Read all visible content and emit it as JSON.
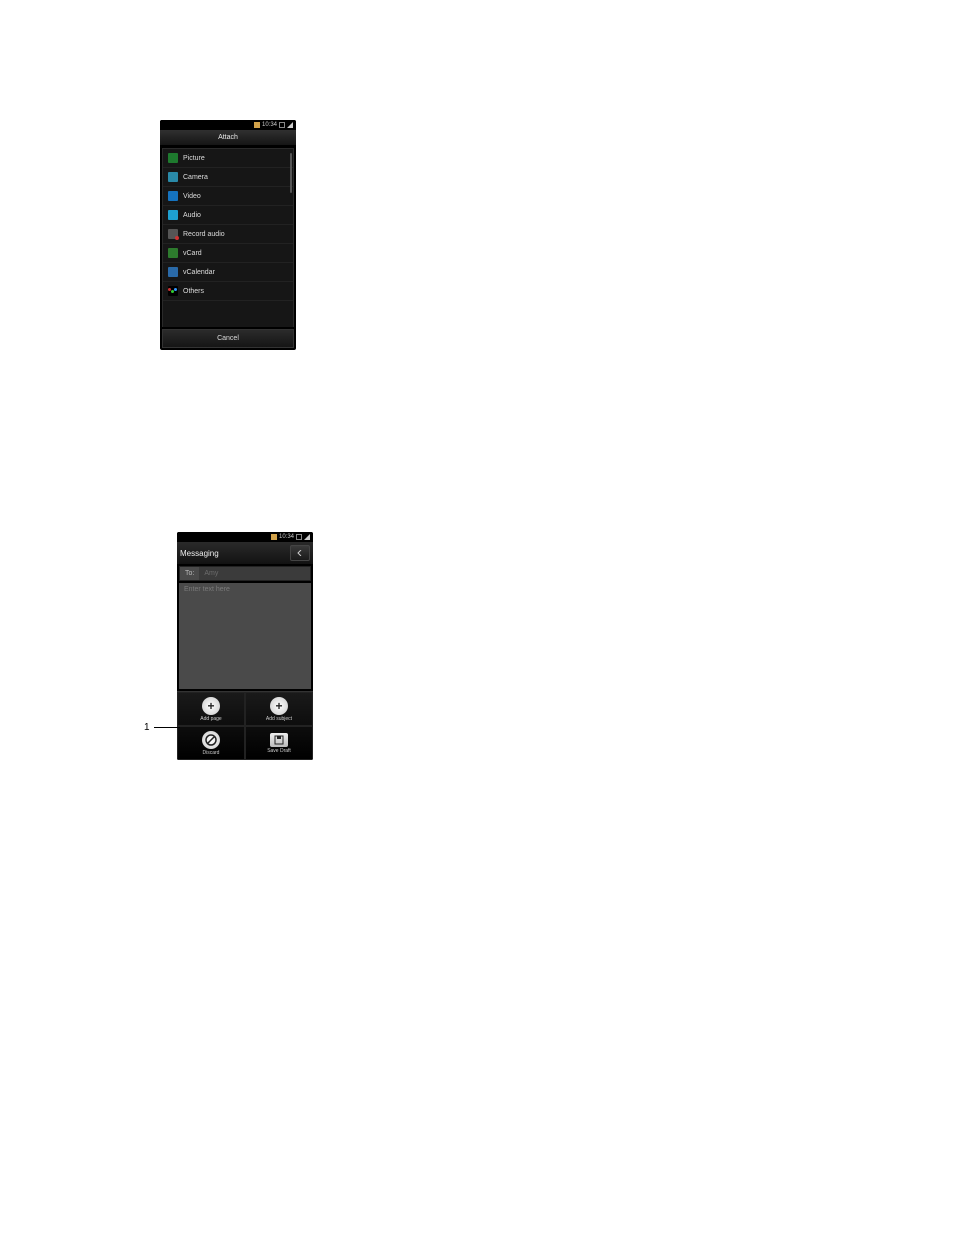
{
  "statusbar": {
    "time": "10:34"
  },
  "attach": {
    "title": "Attach",
    "items": [
      {
        "label": "Picture"
      },
      {
        "label": "Camera"
      },
      {
        "label": "Video"
      },
      {
        "label": "Audio"
      },
      {
        "label": "Record audio"
      },
      {
        "label": "vCard"
      },
      {
        "label": "vCalendar"
      },
      {
        "label": "Others"
      }
    ],
    "cancel": "Cancel"
  },
  "messaging": {
    "title": "Messaging",
    "to_label": "To:",
    "to_value": "Amy",
    "body_placeholder": "Enter text here",
    "menu": {
      "add_page": "Add page",
      "add_subject": "Add subject",
      "discard": "Discard",
      "save_draft": "Save Draft"
    }
  },
  "callouts": {
    "menu_panel": "1"
  }
}
